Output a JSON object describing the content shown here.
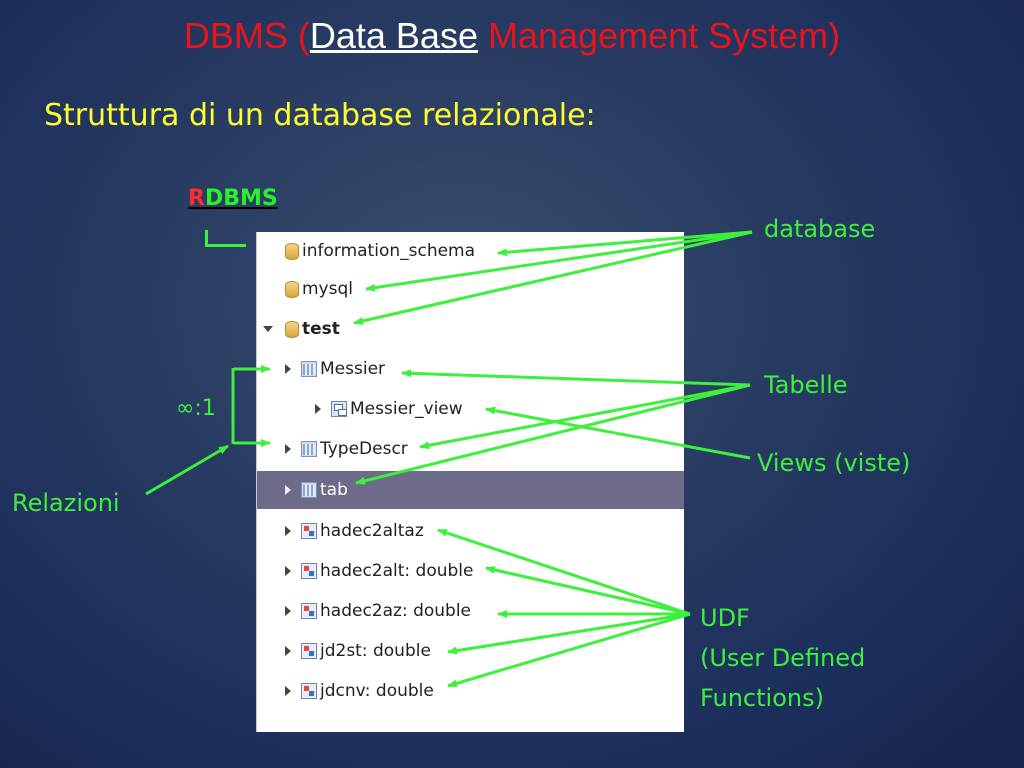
{
  "title": {
    "part1": "DBMS (",
    "part2": "Data Base",
    "part3": " Management System)"
  },
  "subtitle": "Struttura di un database relazionale:",
  "rdbms": {
    "r": "R",
    "rest": "DBMS"
  },
  "labels": {
    "database": "database",
    "tabelle": "Tabelle",
    "views": "Views (viste)",
    "relazioni": "Relazioni",
    "cardinality": "∞:1",
    "udf_line1": "UDF",
    "udf_line2": "(User Defined",
    "udf_line3": "Functions)"
  },
  "tree": [
    {
      "label": "information_schema",
      "icon": "database-icon",
      "expander": "none"
    },
    {
      "label": "mysql",
      "icon": "database-icon",
      "expander": "none"
    },
    {
      "label": "test",
      "icon": "database-icon",
      "expander": "expanded",
      "bold": true
    },
    {
      "label": "Messier",
      "icon": "table-icon",
      "expander": "collapsed"
    },
    {
      "label": "Messier_view",
      "icon": "view-icon",
      "expander": "collapsed"
    },
    {
      "label": "TypeDescr",
      "icon": "table-icon",
      "expander": "collapsed"
    },
    {
      "label": "tab",
      "icon": "table-icon",
      "expander": "collapsed",
      "selected": true
    },
    {
      "label": "hadec2altaz",
      "icon": "function-icon",
      "expander": "collapsed"
    },
    {
      "label": "hadec2alt: double",
      "icon": "function-icon",
      "expander": "collapsed"
    },
    {
      "label": "hadec2az: double",
      "icon": "function-icon",
      "expander": "collapsed"
    },
    {
      "label": "jd2st: double",
      "icon": "function-icon",
      "expander": "collapsed"
    },
    {
      "label": "jdcnv: double",
      "icon": "function-icon",
      "expander": "collapsed"
    }
  ],
  "colors": {
    "title": "#e8141c",
    "subtitle": "#ffff30",
    "green": "#3cf03c",
    "selection": "#6d6b8a"
  }
}
